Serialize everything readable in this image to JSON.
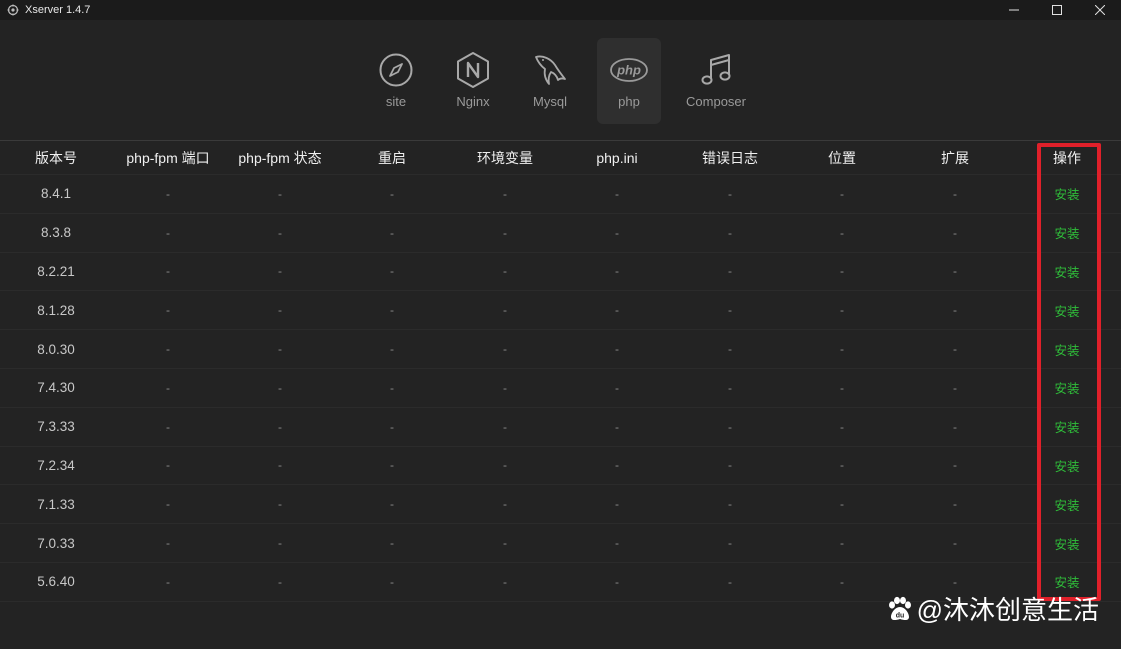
{
  "titlebar": {
    "title": "Xserver 1.4.7",
    "icon": "app-logo-icon",
    "controls": [
      "minimize-icon",
      "maximize-icon",
      "close-icon"
    ]
  },
  "nav": {
    "items": [
      {
        "label": "site",
        "icon": "compass-icon"
      },
      {
        "label": "Nginx",
        "icon": "nginx-hexagon-icon"
      },
      {
        "label": "Mysql",
        "icon": "dolphin-icon"
      },
      {
        "label": "php",
        "icon": "php-logo-icon",
        "active": true
      },
      {
        "label": "Composer",
        "icon": "music-note-icon"
      }
    ]
  },
  "table": {
    "headers": [
      "版本号",
      "php-fpm 端口",
      "php-fpm 状态",
      "重启",
      "环境变量",
      "php.ini",
      "错误日志",
      "位置",
      "扩展",
      "操作"
    ],
    "dash": "-",
    "action_label": "安装",
    "versions": [
      "8.4.1",
      "8.3.8",
      "8.2.21",
      "8.1.28",
      "8.0.30",
      "7.4.30",
      "7.3.33",
      "7.2.34",
      "7.1.33",
      "7.0.33",
      "5.6.40"
    ]
  },
  "watermark": {
    "text": "@沐沐创意生活",
    "icon": "baidu-paw-icon"
  },
  "colors": {
    "background": "#232323",
    "install_green": "#2fbf3a",
    "highlight_red": "#e0202a"
  }
}
